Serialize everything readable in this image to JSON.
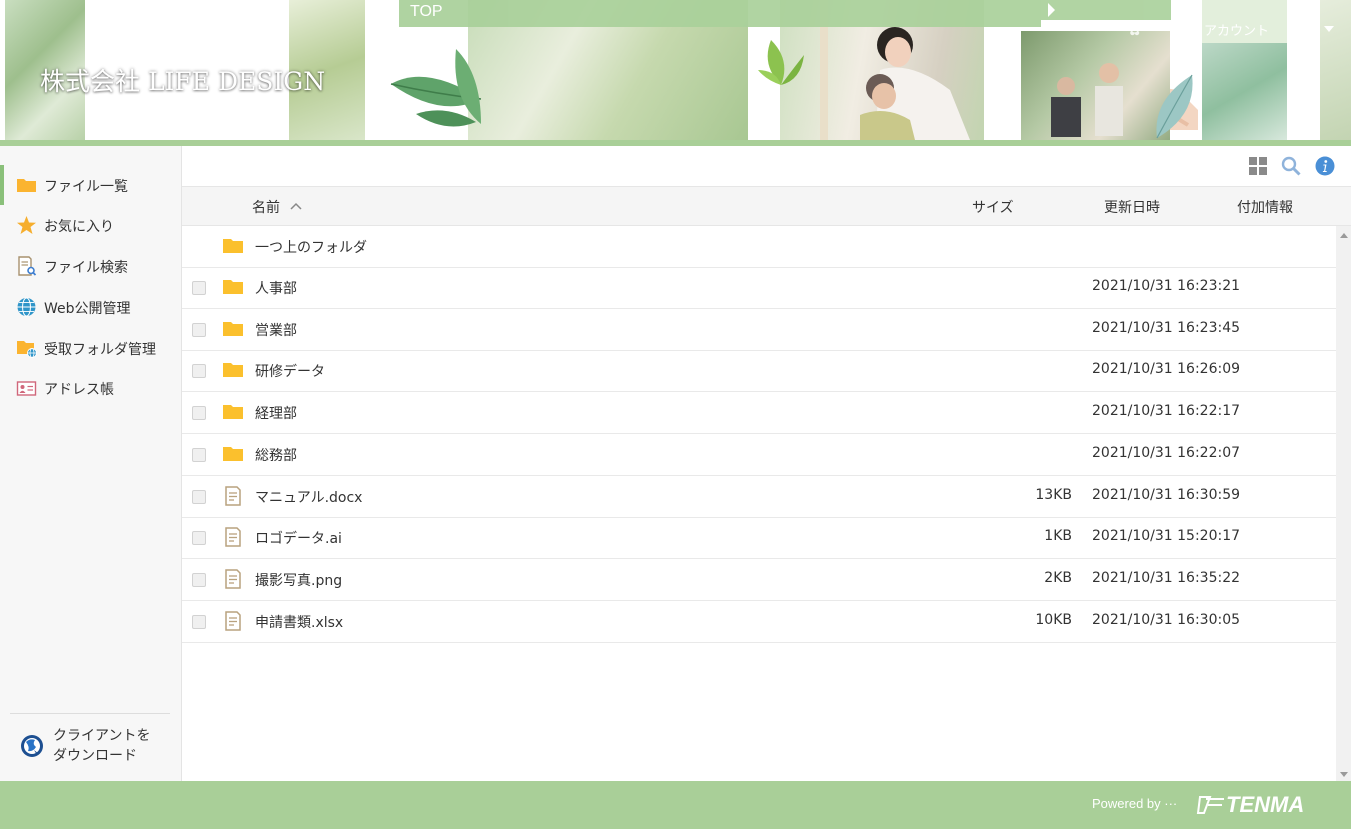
{
  "header": {
    "company_name": "株式会社 LIFE DESIGN",
    "top_nav_label": "TOP",
    "account_label": "アカウント"
  },
  "sidebar": {
    "items": [
      {
        "label": "ファイル一覧",
        "icon": "folder-icon",
        "active": true
      },
      {
        "label": "お気に入り",
        "icon": "star-icon"
      },
      {
        "label": "ファイル検索",
        "icon": "file-search-icon"
      },
      {
        "label": "Web公開管理",
        "icon": "globe-icon"
      },
      {
        "label": "受取フォルダ管理",
        "icon": "receive-folder-icon"
      },
      {
        "label": "アドレス帳",
        "icon": "address-book-icon"
      }
    ],
    "client_download_line1": "クライアントを",
    "client_download_line2": "ダウンロード"
  },
  "toolbar": {
    "icons": [
      "grid-view-icon",
      "search-icon",
      "info-icon"
    ]
  },
  "table": {
    "columns": {
      "name": "名前",
      "size": "サイズ",
      "modified": "更新日時",
      "extra": "付加情報"
    },
    "sort": {
      "column": "name",
      "direction": "asc"
    },
    "parent_folder_label": "一つ上のフォルダ",
    "rows": [
      {
        "name": "人事部",
        "type": "folder",
        "size": "",
        "modified": "2021/10/31 16:23:21"
      },
      {
        "name": "営業部",
        "type": "folder",
        "size": "",
        "modified": "2021/10/31 16:23:45"
      },
      {
        "name": "研修データ",
        "type": "folder",
        "size": "",
        "modified": "2021/10/31 16:26:09"
      },
      {
        "name": "経理部",
        "type": "folder",
        "size": "",
        "modified": "2021/10/31 16:22:17"
      },
      {
        "name": "総務部",
        "type": "folder",
        "size": "",
        "modified": "2021/10/31 16:22:07"
      },
      {
        "name": "マニュアル.docx",
        "type": "file",
        "size": "13KB",
        "modified": "2021/10/31 16:30:59"
      },
      {
        "name": "ロゴデータ.ai",
        "type": "file",
        "size": "1KB",
        "modified": "2021/10/31 15:20:17"
      },
      {
        "name": "撮影写真.png",
        "type": "file",
        "size": "2KB",
        "modified": "2021/10/31 16:35:22"
      },
      {
        "name": "申請書類.xlsx",
        "type": "file",
        "size": "10KB",
        "modified": "2021/10/31 16:30:05"
      }
    ]
  },
  "footer": {
    "powered_by": "Powered by ···",
    "brand": "TENMA"
  },
  "colors": {
    "accent_green": "#a9cf98",
    "folder_yellow": "#fbc02d",
    "file_tan": "#b9a27e",
    "info_blue": "#4a8fd6"
  }
}
